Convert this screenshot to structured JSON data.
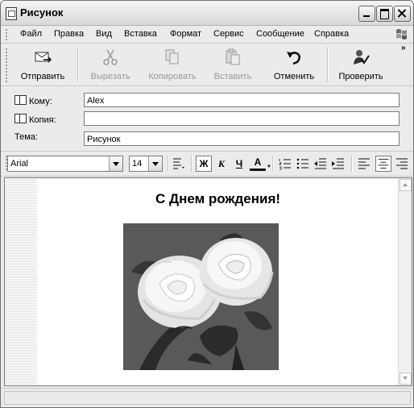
{
  "window": {
    "title": "Рисунок"
  },
  "menu": [
    "Файл",
    "Правка",
    "Вид",
    "Вставка",
    "Формат",
    "Сервис",
    "Сообщение",
    "Справка"
  ],
  "toolbar": {
    "send": "Отправить",
    "cut": "Вырезать",
    "copy": "Копировать",
    "paste": "Вставить",
    "undo": "Отменить",
    "check": "Проверить"
  },
  "header": {
    "to_label": "Кому:",
    "to_value": "Alex",
    "cc_label": "Копия:",
    "cc_value": "",
    "subject_label": "Тема:",
    "subject_value": "Рисунок"
  },
  "format": {
    "font": "Arial",
    "size": "14",
    "bold": "Ж",
    "italic": "К",
    "underline": "Ч",
    "font_color": "A"
  },
  "body": {
    "greeting": "С Днем рождения!"
  },
  "icons": [
    "app-icon",
    "send-icon",
    "scissors-icon",
    "copy-icon",
    "paste-icon",
    "undo-icon",
    "spellcheck-icon",
    "windows-flag-icon"
  ]
}
